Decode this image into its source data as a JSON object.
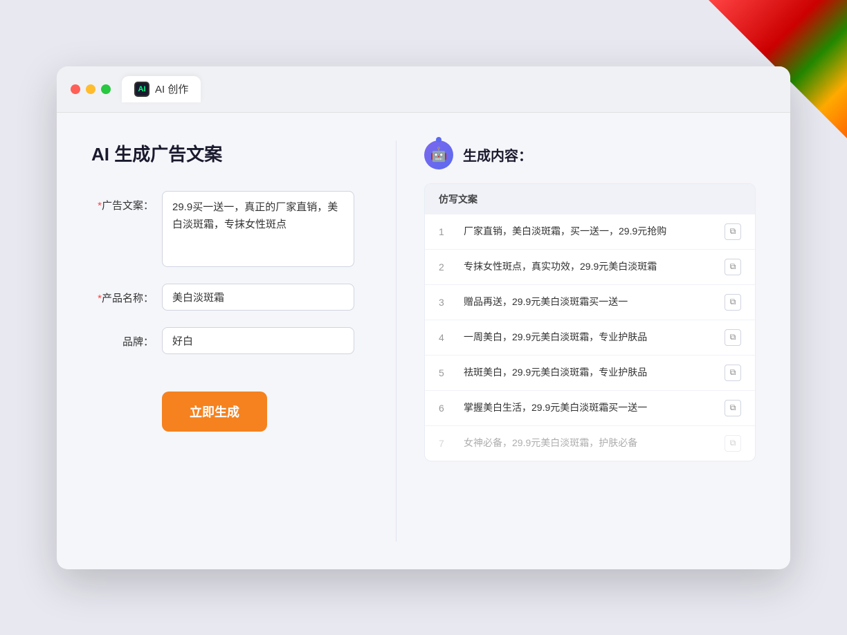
{
  "browser": {
    "tab_label": "AI 创作",
    "tab_icon": "AI"
  },
  "page": {
    "title": "AI 生成广告文案"
  },
  "form": {
    "ad_copy_label": "广告文案：",
    "ad_copy_required": "*",
    "ad_copy_value": "29.9买一送一，真正的厂家直销，美白淡斑霜，专抹女性斑点",
    "product_label": "产品名称：",
    "product_required": "*",
    "product_value": "美白淡斑霜",
    "brand_label": "品牌：",
    "brand_value": "好白",
    "generate_button": "立即生成"
  },
  "result": {
    "header_title": "生成内容：",
    "table_header": "仿写文案",
    "items": [
      {
        "num": "1",
        "text": "厂家直销，美白淡斑霜，买一送一，29.9元抢购",
        "faded": false
      },
      {
        "num": "2",
        "text": "专抹女性斑点，真实功效，29.9元美白淡斑霜",
        "faded": false
      },
      {
        "num": "3",
        "text": "赠品再送，29.9元美白淡斑霜买一送一",
        "faded": false
      },
      {
        "num": "4",
        "text": "一周美白，29.9元美白淡斑霜，专业护肤品",
        "faded": false
      },
      {
        "num": "5",
        "text": "祛斑美白，29.9元美白淡斑霜，专业护肤品",
        "faded": false
      },
      {
        "num": "6",
        "text": "掌握美白生活，29.9元美白淡斑霜买一送一",
        "faded": false
      },
      {
        "num": "7",
        "text": "女神必备，29.9元美白淡斑霜，护肤必备",
        "faded": true
      }
    ]
  }
}
